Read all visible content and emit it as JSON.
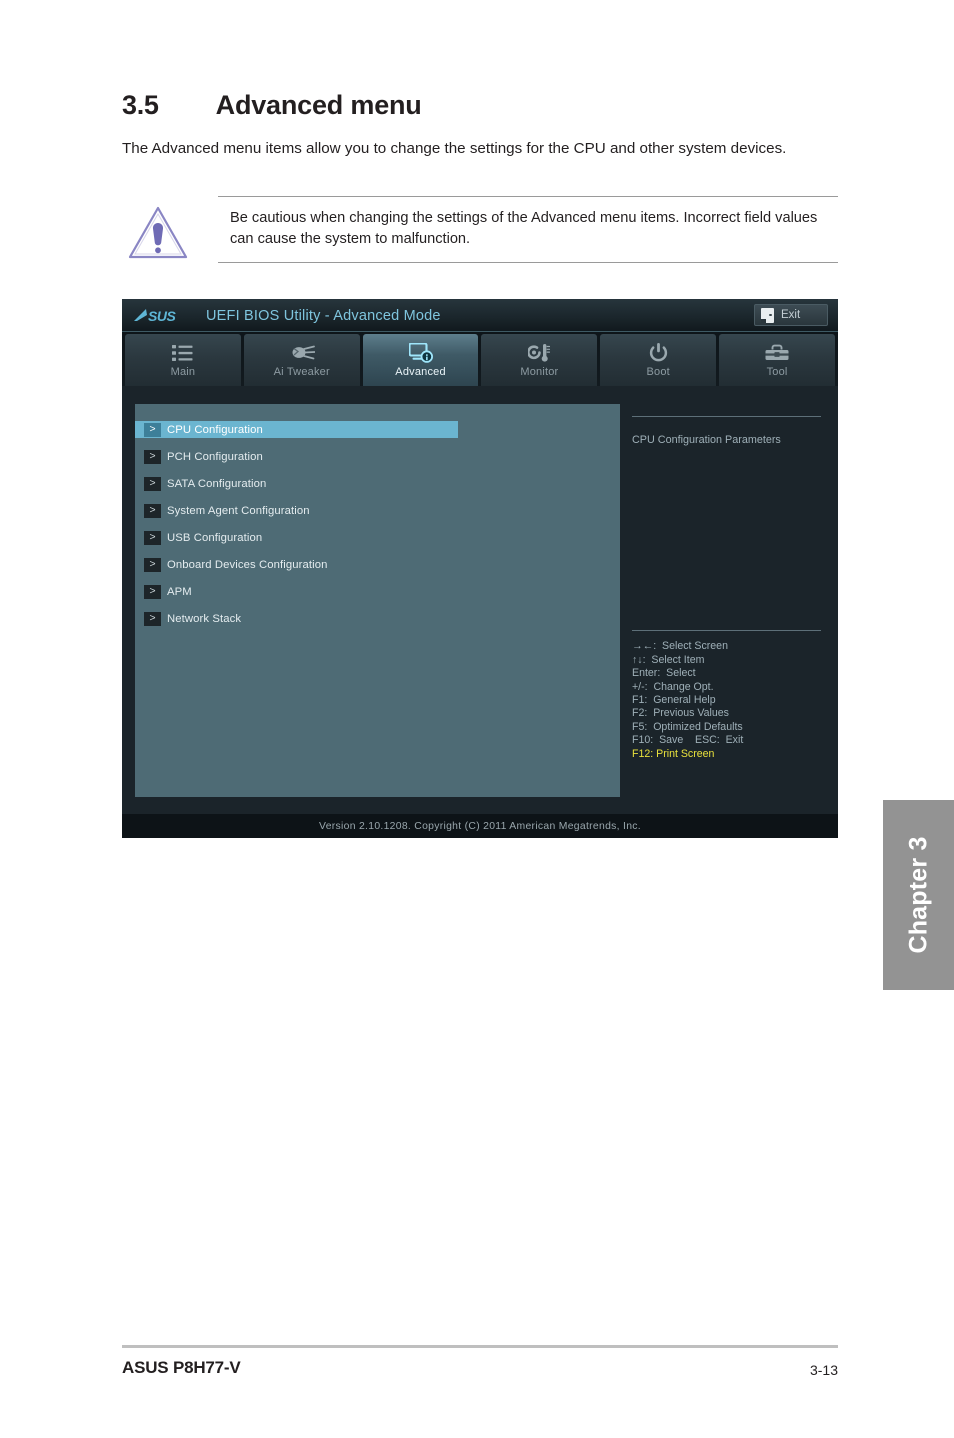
{
  "document": {
    "section_number": "3.5",
    "section_title": "Advanced menu",
    "intro": "The Advanced menu items allow you to change the settings for the CPU and other system devices.",
    "caution_icon": "warning-triangle-icon",
    "caution_text": "Be cautious when changing the settings of the Advanced menu items. Incorrect field values can cause the system to malfunction."
  },
  "chapter_tab": {
    "label": "Chapter 3"
  },
  "footer": {
    "product": "ASUS P8H77-V",
    "page_number": "3-13"
  },
  "bios": {
    "logo": "asus-logo",
    "title": "UEFI BIOS Utility - Advanced Mode",
    "exit_button": {
      "label": "Exit",
      "icon": "exit-door-icon"
    },
    "tabs": [
      {
        "label": "Main",
        "icon": "list-icon",
        "active": false
      },
      {
        "label": "Ai  Tweaker",
        "icon": "comet-icon",
        "active": false
      },
      {
        "label": "Advanced",
        "icon": "monitor-info-icon",
        "active": true
      },
      {
        "label": "Monitor",
        "icon": "thermometer-fan-icon",
        "active": false
      },
      {
        "label": "Boot",
        "icon": "power-icon",
        "active": false
      },
      {
        "label": "Tool",
        "icon": "toolbox-icon",
        "active": false
      }
    ],
    "menu_items": [
      {
        "arrow": ">",
        "label": "CPU Configuration",
        "selected": true
      },
      {
        "arrow": ">",
        "label": "PCH Configuration",
        "selected": false
      },
      {
        "arrow": ">",
        "label": "SATA Configuration",
        "selected": false
      },
      {
        "arrow": ">",
        "label": "System Agent Configuration",
        "selected": false
      },
      {
        "arrow": ">",
        "label": "USB Configuration",
        "selected": false
      },
      {
        "arrow": ">",
        "label": "Onboard Devices Configuration",
        "selected": false
      },
      {
        "arrow": ">",
        "label": "APM",
        "selected": false
      },
      {
        "arrow": ">",
        "label": "Network Stack",
        "selected": false
      }
    ],
    "help_text": "CPU Configuration Parameters",
    "legend": [
      {
        "text": "→←:  Select Screen",
        "highlight": false
      },
      {
        "text": "↑↓:  Select Item",
        "highlight": false
      },
      {
        "text": "Enter:  Select",
        "highlight": false
      },
      {
        "text": "+/-:  Change Opt.",
        "highlight": false
      },
      {
        "text": "F1:  General Help",
        "highlight": false
      },
      {
        "text": "F2:  Previous Values",
        "highlight": false
      },
      {
        "text": "F5:  Optimized Defaults",
        "highlight": false
      },
      {
        "text": "F10:  Save    ESC:  Exit",
        "highlight": false
      },
      {
        "text": "F12: Print Screen",
        "highlight": true
      }
    ],
    "version_footer": "Version  2.10.1208.   Copyright  (C)  2011  American  Megatrends,  Inc.",
    "colors": {
      "accent_cyan": "#7fc5de",
      "selection_blue": "#6bb5d0",
      "left_pane": "#4e6b75",
      "hotkey_yellow": "#e8e13c"
    }
  }
}
